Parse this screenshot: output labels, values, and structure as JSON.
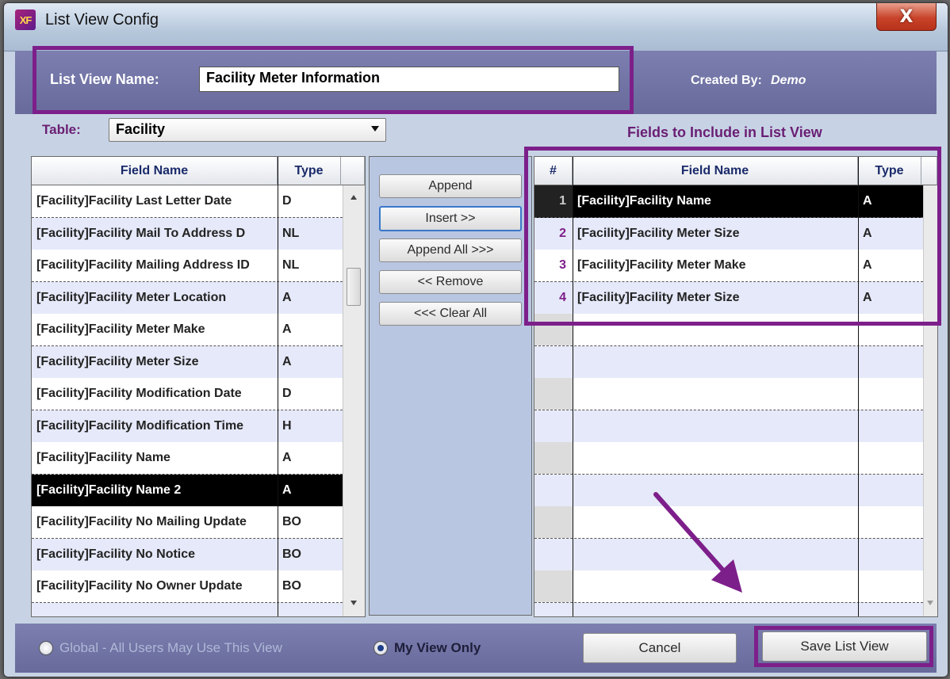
{
  "window": {
    "app_icon": "XF",
    "title": "List View Config",
    "close_glyph": "X"
  },
  "header": {
    "name_label": "List View Name:",
    "name_value": "Facility Meter Information",
    "created_by_label": "Created By:",
    "created_by_value": "Demo"
  },
  "table_selector": {
    "label": "Table:",
    "value": "Facility"
  },
  "available_fields": {
    "columns": [
      "Field Name",
      "Type"
    ],
    "rows": [
      {
        "name": "[Facility]Facility Last Letter Date",
        "type": "D"
      },
      {
        "name": "[Facility]Facility Mail To Address D",
        "type": "NL"
      },
      {
        "name": "[Facility]Facility Mailing Address ID",
        "type": "NL"
      },
      {
        "name": "[Facility]Facility Meter Location",
        "type": "A"
      },
      {
        "name": "[Facility]Facility Meter Make",
        "type": "A"
      },
      {
        "name": "[Facility]Facility Meter Size",
        "type": "A"
      },
      {
        "name": "[Facility]Facility Modification Date",
        "type": "D"
      },
      {
        "name": "[Facility]Facility Modification Time",
        "type": "H"
      },
      {
        "name": "[Facility]Facility Name",
        "type": "A"
      },
      {
        "name": "[Facility]Facility Name 2",
        "type": "A"
      },
      {
        "name": "[Facility]Facility No Mailing Update",
        "type": "BO"
      },
      {
        "name": "[Facility]Facility No Notice",
        "type": "BO"
      },
      {
        "name": "[Facility]Facility No Owner Update",
        "type": "BO"
      }
    ],
    "selected_index": 9
  },
  "actions": {
    "append": "Append",
    "insert": "Insert >>",
    "append_all": "Append All >>>",
    "remove": "<< Remove",
    "clear_all": "<<< Clear All"
  },
  "included_fields": {
    "heading": "Fields to Include in List View",
    "columns": [
      "#",
      "Field Name",
      "Type"
    ],
    "rows": [
      {
        "num": "1",
        "name": "[Facility]Facility Name",
        "type": "A"
      },
      {
        "num": "2",
        "name": "[Facility]Facility Meter Size",
        "type": "A"
      },
      {
        "num": "3",
        "name": "[Facility]Facility Meter Make",
        "type": "A"
      },
      {
        "num": "4",
        "name": "[Facility]Facility Meter Size",
        "type": "A"
      }
    ],
    "selected_index": 0
  },
  "footer": {
    "global_label": "Global - All Users May Use This View",
    "my_view_label": "My View Only",
    "selected_option": "My View Only",
    "cancel": "Cancel",
    "save": "Save List View"
  },
  "colors": {
    "highlight": "#7d1f8a",
    "panel": "#6e71a2",
    "selected_row": "#000000"
  }
}
